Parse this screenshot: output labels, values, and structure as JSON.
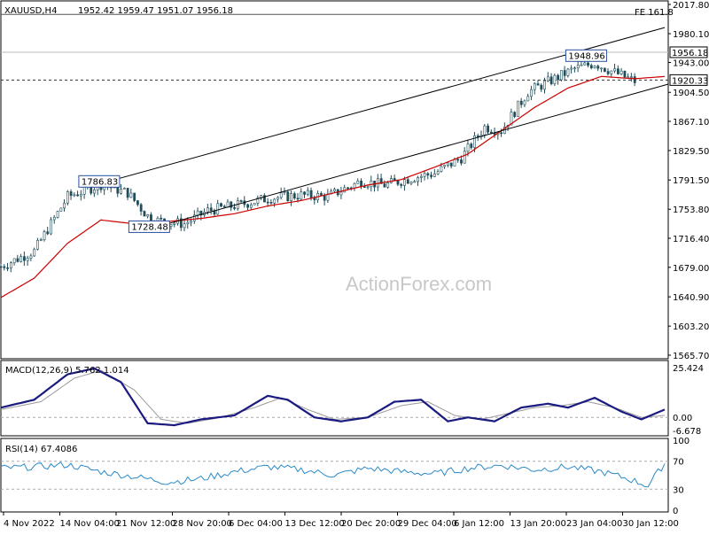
{
  "header": {
    "symbol": "XAUUSD,H4",
    "ohlc": "1952.42 1959.47 1951.07 1956.18",
    "fib_label": "FE 161.8"
  },
  "watermark": "ActionForex.com",
  "colors": {
    "candle": "#1f4e5a",
    "sma": "#cc0000",
    "macd": "#1a1a80",
    "signal": "#9a9a9a",
    "rsi": "#2a8ac8",
    "channel": "#000000",
    "fib": "#555555",
    "grid_dash": "#999999",
    "panel_border": "#000000"
  },
  "price_labels": {
    "current": "1956.18",
    "support": "1920.33",
    "high": "1948.96",
    "swing_high": "1786.83",
    "swing_low": "1728.48"
  },
  "macd": {
    "label": "MACD(12,26,9) 5.762 1.014",
    "axis_top": "25.424",
    "axis_zero": "0.00",
    "axis_bottom": "-6.678"
  },
  "rsi": {
    "label": "RSI(14) 67.4086",
    "axis_top": "100",
    "axis_70": "70",
    "axis_30": "30",
    "axis_0": "0"
  },
  "chart_data": [
    {
      "type": "candlestick",
      "title": "XAUUSD,H4 1952.42 1959.47 1951.07 1956.18",
      "y_ticks": [
        "2017.80",
        "1980.10",
        "1943.00",
        "1904.50",
        "1867.10",
        "1829.50",
        "1791.50",
        "1753.80",
        "1716.40",
        "1679.00",
        "1640.90",
        "1603.20",
        "1565.70"
      ],
      "x_ticks": [
        "4 Nov 2022",
        "14 Nov 04:00",
        "21 Nov 12:00",
        "28 Nov 20:00",
        "6 Dec 04:00",
        "13 Dec 12:00",
        "20 Dec 20:00",
        "29 Dec 04:00",
        "6 Jan 12:00",
        "13 Jan 20:00",
        "23 Jan 04:00",
        "30 Jan 12:00"
      ],
      "ylim": [
        1565.7,
        2017.8
      ],
      "x_count": 180,
      "close_path": [
        [
          0,
          1680
        ],
        [
          10,
          1700
        ],
        [
          20,
          1770
        ],
        [
          30,
          1786
        ],
        [
          38,
          1775
        ],
        [
          45,
          1740
        ],
        [
          55,
          1735
        ],
        [
          62,
          1752
        ],
        [
          72,
          1760
        ],
        [
          80,
          1768
        ],
        [
          90,
          1772
        ],
        [
          98,
          1770
        ],
        [
          108,
          1790
        ],
        [
          115,
          1785
        ],
        [
          124,
          1795
        ],
        [
          130,
          1800
        ],
        [
          138,
          1820
        ],
        [
          145,
          1860
        ],
        [
          150,
          1855
        ],
        [
          158,
          1905
        ],
        [
          165,
          1920
        ],
        [
          172,
          1935
        ],
        [
          178,
          1942
        ],
        [
          184,
          1930
        ],
        [
          192,
          1915
        ],
        [
          199,
          1956
        ]
      ],
      "sma_path": [
        [
          0,
          1640
        ],
        [
          10,
          1665
        ],
        [
          20,
          1710
        ],
        [
          30,
          1740
        ],
        [
          40,
          1735
        ],
        [
          50,
          1738
        ],
        [
          60,
          1742
        ],
        [
          70,
          1748
        ],
        [
          80,
          1758
        ],
        [
          90,
          1765
        ],
        [
          100,
          1775
        ],
        [
          110,
          1785
        ],
        [
          120,
          1792
        ],
        [
          130,
          1808
        ],
        [
          140,
          1825
        ],
        [
          150,
          1855
        ],
        [
          160,
          1885
        ],
        [
          170,
          1910
        ],
        [
          180,
          1925
        ],
        [
          190,
          1922
        ],
        [
          199,
          1925
        ]
      ],
      "channel_upper": [
        [
          30,
          1787
        ],
        [
          199,
          1988
        ]
      ],
      "channel_lower": [
        [
          45,
          1729
        ],
        [
          199,
          1915
        ]
      ],
      "fib_level": 2005,
      "support_level": 1920.33,
      "current_level": 1956.18,
      "annotations": [
        {
          "text": "1786.83",
          "x": 30,
          "y": 1786.83
        },
        {
          "text": "1728.48",
          "x": 45,
          "y": 1728.48
        },
        {
          "text": "1948.96",
          "x": 176,
          "y": 1948.96
        }
      ]
    },
    {
      "type": "line",
      "title": "MACD(12,26,9) 5.762 1.014",
      "ylim": [
        -6.678,
        25.424
      ],
      "series": [
        {
          "values_path": [
            [
              0,
              5
            ],
            [
              10,
              9
            ],
            [
              20,
              22
            ],
            [
              28,
              25
            ],
            [
              36,
              18
            ],
            [
              44,
              -3
            ],
            [
              52,
              -4
            ],
            [
              60,
              -1
            ],
            [
              70,
              1
            ],
            [
              80,
              11
            ],
            [
              86,
              9
            ],
            [
              94,
              0
            ],
            [
              102,
              -2
            ],
            [
              110,
              0
            ],
            [
              118,
              8
            ],
            [
              126,
              9
            ],
            [
              134,
              -2
            ],
            [
              140,
              0
            ],
            [
              148,
              -2
            ],
            [
              156,
              5
            ],
            [
              164,
              7
            ],
            [
              170,
              5
            ],
            [
              178,
              10
            ],
            [
              186,
              3
            ],
            [
              192,
              -1
            ],
            [
              199,
              4
            ]
          ]
        },
        {
          "values_path": [
            [
              0,
              4
            ],
            [
              12,
              8
            ],
            [
              22,
              20
            ],
            [
              30,
              24
            ],
            [
              40,
              14
            ],
            [
              48,
              -1
            ],
            [
              56,
              -3
            ],
            [
              66,
              0
            ],
            [
              76,
              5
            ],
            [
              84,
              10
            ],
            [
              92,
              4
            ],
            [
              100,
              -1
            ],
            [
              110,
              0
            ],
            [
              120,
              6
            ],
            [
              128,
              8
            ],
            [
              136,
              1
            ],
            [
              144,
              -1
            ],
            [
              152,
              2
            ],
            [
              160,
              5
            ],
            [
              168,
              6
            ],
            [
              176,
              8
            ],
            [
              184,
              5
            ],
            [
              192,
              0
            ],
            [
              199,
              1
            ]
          ]
        }
      ]
    },
    {
      "type": "line",
      "title": "RSI(14) 67.4086",
      "ylim": [
        0,
        100
      ],
      "series": [
        {
          "values_path": [
            [
              0,
              60
            ],
            [
              10,
              62
            ],
            [
              20,
              65
            ],
            [
              30,
              55
            ],
            [
              40,
              48
            ],
            [
              50,
              40
            ],
            [
              60,
              45
            ],
            [
              70,
              55
            ],
            [
              80,
              62
            ],
            [
              90,
              58
            ],
            [
              100,
              50
            ],
            [
              110,
              60
            ],
            [
              120,
              55
            ],
            [
              130,
              52
            ],
            [
              140,
              60
            ],
            [
              150,
              64
            ],
            [
              160,
              58
            ],
            [
              170,
              62
            ],
            [
              180,
              55
            ],
            [
              188,
              45
            ],
            [
              194,
              35
            ],
            [
              199,
              67.4
            ]
          ]
        }
      ]
    }
  ]
}
